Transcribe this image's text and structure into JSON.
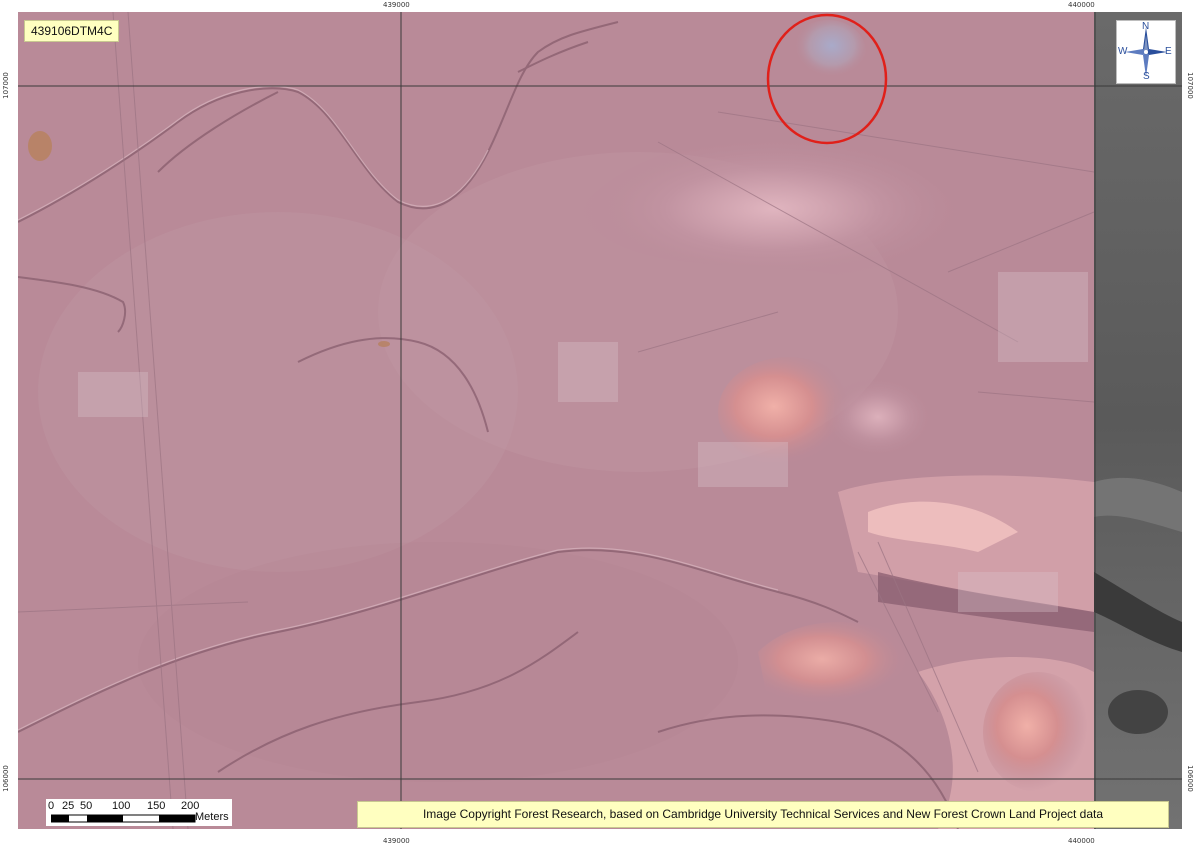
{
  "map": {
    "sheet_id": "439106DTM4C",
    "copyright": "Image Copyright Forest Research, based on Cambridge University Technical Services and New Forest Crown Land Project data",
    "grid": {
      "easting_labels": [
        "439000",
        "440000"
      ],
      "northing_labels": [
        "107000",
        "106000"
      ]
    },
    "north_arrow": {
      "icon": "compass-rose-icon",
      "n": "N",
      "s": "S",
      "e": "E",
      "w": "W"
    },
    "scale_bar": {
      "ticks": [
        "0",
        "25",
        "50",
        "100",
        "150",
        "200"
      ],
      "units": "Meters"
    },
    "colors": {
      "terrain_base": "#b98a98",
      "terrain_light": "#cfa4b0",
      "terrain_shadow": "#8f6676",
      "highlight_red": "#e08a86",
      "grayscale_strip": "#5a5a5a",
      "annotation_circle": "#e0201a",
      "label_bg": "#ffffc0"
    }
  }
}
